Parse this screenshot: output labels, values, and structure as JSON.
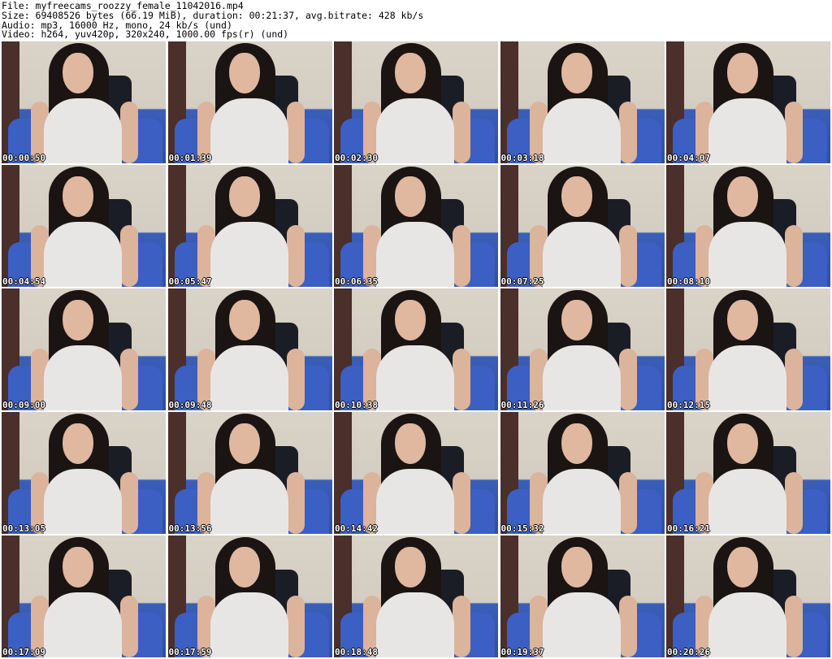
{
  "header": {
    "file_line": "File: myfreecams_roozzy_female_11042016.mp4",
    "size_line": "Size: 69408526 bytes (66.19 MiB), duration: 00:21:37, avg.bitrate: 428 kb/s",
    "audio_line": "Audio: mp3, 16000 Hz, mono, 24 kb/s (und)",
    "video_line": "Video: h264, yuv420p, 320x240, 1000.00 fps(r) (und)"
  },
  "thumbnails": [
    {
      "timestamp": "00:00:50"
    },
    {
      "timestamp": "00:01:39"
    },
    {
      "timestamp": "00:02:30"
    },
    {
      "timestamp": "00:03:18"
    },
    {
      "timestamp": "00:04:07"
    },
    {
      "timestamp": "00:04:54"
    },
    {
      "timestamp": "00:05:47"
    },
    {
      "timestamp": "00:06:35"
    },
    {
      "timestamp": "00:07:25"
    },
    {
      "timestamp": "00:08:10"
    },
    {
      "timestamp": "00:09:00"
    },
    {
      "timestamp": "00:09:48"
    },
    {
      "timestamp": "00:10:38"
    },
    {
      "timestamp": "00:11:26"
    },
    {
      "timestamp": "00:12:15"
    },
    {
      "timestamp": "00:13:05"
    },
    {
      "timestamp": "00:13:56"
    },
    {
      "timestamp": "00:14:42"
    },
    {
      "timestamp": "00:15:32"
    },
    {
      "timestamp": "00:16:21"
    },
    {
      "timestamp": "00:17:09"
    },
    {
      "timestamp": "00:17:59"
    },
    {
      "timestamp": "00:18:48"
    },
    {
      "timestamp": "00:19:37"
    },
    {
      "timestamp": "00:20:26"
    }
  ]
}
